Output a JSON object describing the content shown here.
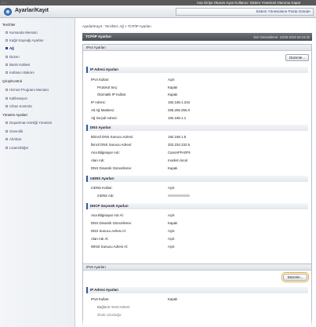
{
  "topbar": {
    "links": "Ana Girişe  Oturum Açan Kullanıcı: Sistem Yöneticisi Oturumu Kapat"
  },
  "header": {
    "title": "Ayarlar/Kayıt",
    "admin_button": "Sistem Yöneticisine Posta Gönder"
  },
  "sidebar": {
    "items": [
      {
        "label": "Tercihler",
        "kind": "head"
      },
      {
        "label": "Kumanda Menüsü",
        "kind": "item"
      },
      {
        "label": "Kağıt Kaynağı Ayarları",
        "kind": "item"
      },
      {
        "label": "Ağ",
        "kind": "active"
      },
      {
        "label": "Düzen",
        "kind": "item"
      },
      {
        "label": "Baskı Kalitesi",
        "kind": "item"
      },
      {
        "label": "Kullanıcı Bakımı",
        "kind": "item"
      },
      {
        "label": "Çıkış/Kontrol",
        "kind": "head"
      },
      {
        "label": "Hizmet Programı Menüsü",
        "kind": "item"
      },
      {
        "label": "Kalibrasyon",
        "kind": "item"
      },
      {
        "label": "Cihaz Kontrolü",
        "kind": "item"
      },
      {
        "label": "Yönetim Ayarları",
        "kind": "head"
      },
      {
        "label": "Departman Kimliği Yönetimi",
        "kind": "item"
      },
      {
        "label": "Güvenlik",
        "kind": "item"
      },
      {
        "label": "Al/Aktar",
        "kind": "item"
      },
      {
        "label": "Lisans/Diğer",
        "kind": "item"
      }
    ]
  },
  "main": {
    "breadcrumb": "Ayarlar/Kayıt : Tercihler: Ağ > TCP/IP Ayarları",
    "page_title": "TCP/IP Ayarları",
    "last_updated": "Son Güncelleme: 21/08 2019 04:24:32",
    "ipv4": {
      "box_title": "IPv4 Ayarları",
      "edit_button": "Düzenle...",
      "sections": [
        {
          "title": "IP Adresi Ayarları",
          "rows": [
            {
              "label": "IPv4 Kullan:",
              "value": "Açık",
              "sub": false
            },
            {
              "label": "Protokol Seç:",
              "value": "Kapalı",
              "sub": true
            },
            {
              "label": "Otomatik IP Kullan:",
              "value": "Kapalı",
              "sub": true
            },
            {
              "label": "IP Adresi:",
              "value": "192.168.1.234",
              "sub": false
            },
            {
              "label": "Alt Ağ Maskesi:",
              "value": "255.255.255.0",
              "sub": false
            },
            {
              "label": "Ağ Geçidi Adresi:",
              "value": "192.168.1.1",
              "sub": false
            }
          ]
        },
        {
          "title": "DNS Ayarları",
          "rows": [
            {
              "label": "Birincil DNS Sunucu Adresi:",
              "value": "192.168.1.5",
              "sub": false
            },
            {
              "label": "İkincil DNS Sunucu Adresi:",
              "value": "202.234.232.6",
              "sub": false
            },
            {
              "label": "Ana Bilgisayar Adı:",
              "value": "CanonFFA0F9",
              "sub": false
            },
            {
              "label": "Alan Adı:",
              "value": "modem.local",
              "sub": false
            },
            {
              "label": "DNS Dinamik Güncelleme:",
              "value": "Kapalı",
              "sub": false
            }
          ]
        },
        {
          "title": "mDNS Ayarları",
          "rows": [
            {
              "label": "mDNS Kullan:",
              "value": "Açık",
              "sub": false
            },
            {
              "label": "mDNS Adı:",
              "value": "",
              "sub": true
            }
          ]
        },
        {
          "title": "DHCP Seçenek Ayarları",
          "rows": [
            {
              "label": "Ana Bilgisayar Adı Al:",
              "value": "Açık",
              "sub": false
            },
            {
              "label": "DNS Dinamik Güncelleme:",
              "value": "Kapalı",
              "sub": false
            },
            {
              "label": "DNS Sunucu Adresi Al:",
              "value": "Açık",
              "sub": false
            },
            {
              "label": "Alan Adı Al:",
              "value": "Açık",
              "sub": false
            },
            {
              "label": "WINS Sunucu Adresi Al:",
              "value": "Açık",
              "sub": false
            }
          ]
        }
      ]
    },
    "ipv6": {
      "box_title": "IPv6 Ayarları",
      "edit_button": "Düzenle...",
      "section_title": "IP Adresi Ayarları",
      "rows": [
        {
          "label": "IPv6 Kullan:",
          "value": "Kapalı",
          "sub": false
        },
        {
          "label": "Bağlantı-Yerel Adresi:",
          "value": "",
          "sub": true
        },
        {
          "label": "Önek Uzunluğu:",
          "value": "",
          "sub": true
        }
      ]
    }
  },
  "colors": {
    "accent": "#2b5aa8",
    "highlight": "#f0a81e",
    "titlebar": "#4a4e54"
  }
}
